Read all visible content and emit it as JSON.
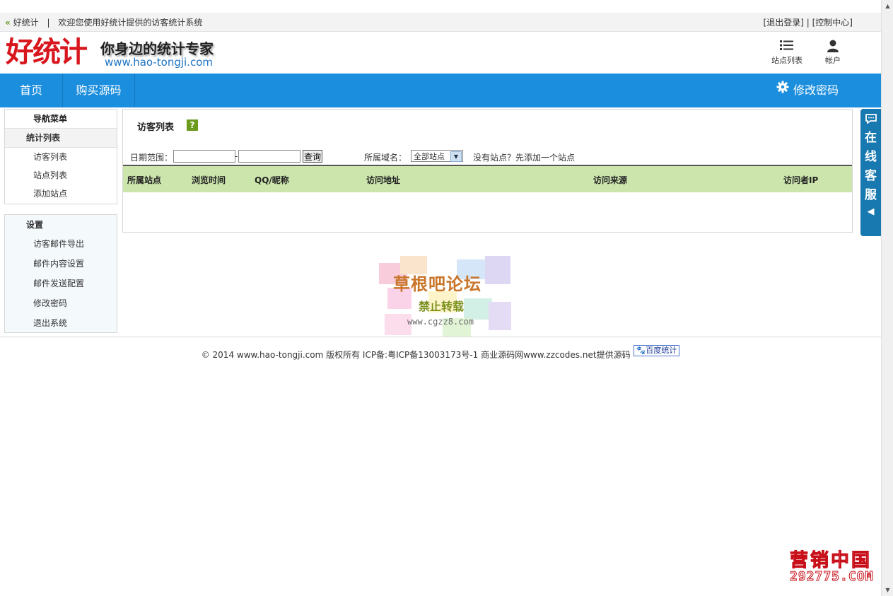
{
  "topbar": {
    "brand": "好统计",
    "welcome": "欢迎您使用好统计提供的访客统计系统",
    "logout": "[退出登录]",
    "control": "[控制中心]",
    "divider": "|"
  },
  "header": {
    "logo": "好统计",
    "slogan": "你身边的统计专家",
    "url": "www.hao-tongji.com",
    "site_list": "站点列表",
    "account": "帐户"
  },
  "nav": {
    "home": "首页",
    "buy": "购买源码",
    "change_password": "修改密码"
  },
  "sidebar": {
    "title": "导航菜单",
    "stats_group": "统计列表",
    "stats_items": [
      "访客列表",
      "站点列表",
      "添加站点"
    ],
    "settings_group": "设置",
    "settings_items": [
      "访客邮件导出",
      "邮件内容设置",
      "邮件发送配置",
      "修改密码",
      "退出系统"
    ]
  },
  "main": {
    "title": "访客列表",
    "help": "?",
    "date_label": "日期范围：",
    "date_dash": "-",
    "query": "查询",
    "domain_label": "所属域名：",
    "domain_selected": "全部站点",
    "no_site": "没有站点？先添加一个站点",
    "columns": [
      "所属站点",
      "浏览时间",
      "QQ/昵称",
      "访问地址",
      "访问来源",
      "访问者IP"
    ]
  },
  "watermark": {
    "line1": "草根吧论坛",
    "line2": "禁止转载",
    "line3": "www.cgzz8.com"
  },
  "footer": {
    "text": "© 2014 www.hao-tongji.com 版权所有 ICP备:粤ICP备13003173号-1 商业源码网www.zzcodes.net提供源码",
    "badge": "百度统计"
  },
  "service": {
    "chars": [
      "在",
      "线",
      "客",
      "服"
    ],
    "arrow": "◀"
  },
  "brand": {
    "line1": "营销中国",
    "line2": "292775.COM"
  },
  "colors": {
    "nav": "#1b8ede",
    "logo_red": "#d8161e",
    "table_header": "#cce5ad",
    "service_blue": "#1779b0"
  }
}
